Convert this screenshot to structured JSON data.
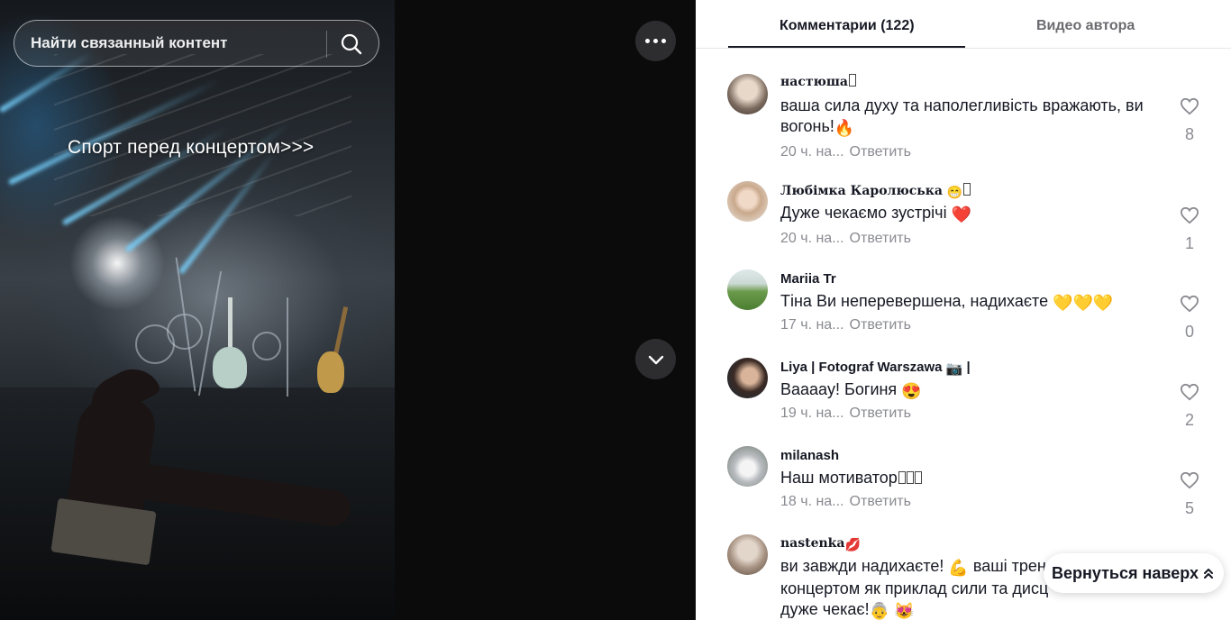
{
  "video": {
    "caption": "Спорт перед концертом>>>",
    "search_placeholder": "Найти связанный контент",
    "icons": {
      "search": "search-icon",
      "more": "more-options-icon",
      "next": "chevron-down-icon"
    }
  },
  "tabs": {
    "comments": "Комментарии (122)",
    "creator_videos": "Видео автора",
    "partial_above": "... ч. на... Ответить"
  },
  "comments": [
    {
      "username": "настюша",
      "text": "ваша сила духу та наполегливість вражають, ви вогонь!",
      "text_emoji": "🔥",
      "time": "20 ч. на...",
      "reply": "Ответить",
      "likes": "8"
    },
    {
      "username": "Любімка Каролюська",
      "text": "Дуже чекаємо зустрічі",
      "text_emoji": "❤️",
      "time": "20 ч. на...",
      "reply": "Ответить",
      "likes": "1"
    },
    {
      "username": "Mariia Tr",
      "text": "Тіна Ви неперевершена, надихаєте",
      "text_emoji": "💛💛💛",
      "time": "17 ч. на...",
      "reply": "Ответить",
      "likes": "0"
    },
    {
      "username": "Liya | Fotograf Warszawa",
      "username_suffix": "|",
      "text": "Вааааy! Богиня",
      "text_emoji": "😍",
      "time": "19 ч. на...",
      "reply": "Ответить",
      "likes": "2"
    },
    {
      "username": "milanash",
      "text": "Наш мотиватор",
      "time": "18 ч. на...",
      "reply": "Ответить",
      "likes": "5"
    },
    {
      "username": "nastenka",
      "text_line1": "ви завжди надихаєте!",
      "text_line1b": "ваші трен",
      "text_line2": "концертом як приклад сили та дисц",
      "text_line3": "дуже чекає!",
      "likes": ""
    }
  ],
  "back_to_top": {
    "label": "Вернуться наверх"
  },
  "colors": {
    "panel_bg": "#ffffff",
    "video_bg": "#0b0b0c",
    "text_primary": "#161823",
    "text_secondary": "#8a8b91",
    "like_outline": "#8a8b91"
  }
}
